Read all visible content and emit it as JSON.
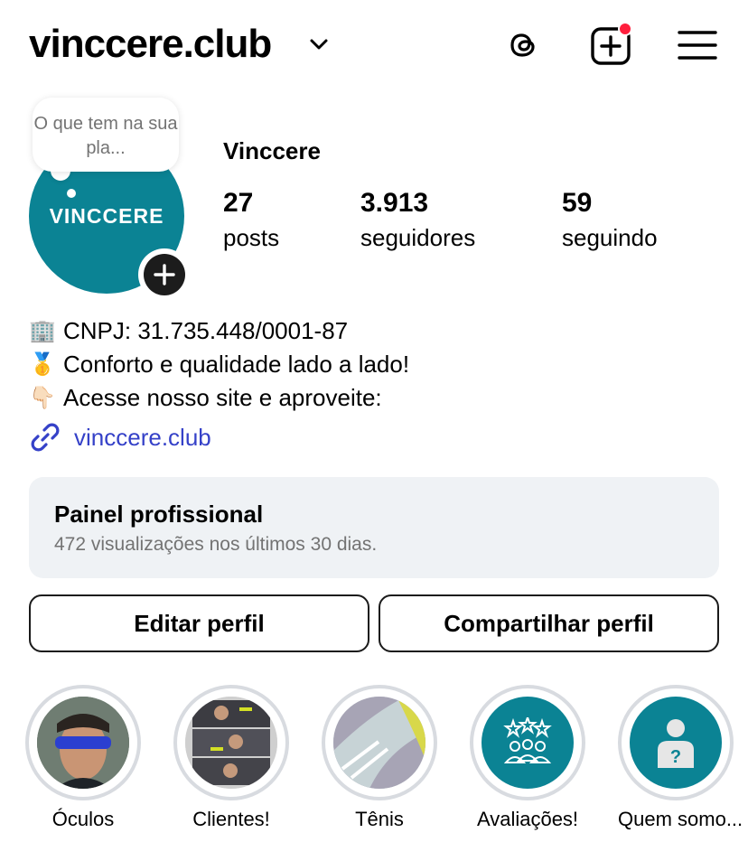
{
  "header": {
    "username": "vinccere.club",
    "icons": [
      "threads-icon",
      "new-post-icon",
      "menu-icon"
    ]
  },
  "note": {
    "text": "O que tem na sua pla..."
  },
  "profile": {
    "display_name": "Vinccere",
    "avatar_text": "VINCCERE",
    "stats": [
      {
        "value": "27",
        "label": "posts"
      },
      {
        "value": "3.913",
        "label": "seguidores"
      },
      {
        "value": "59",
        "label": "seguindo"
      }
    ]
  },
  "bio": {
    "lines": [
      {
        "emoji": "🏢",
        "text": "CNPJ: 31.735.448/0001-87"
      },
      {
        "emoji": "🥇",
        "text": "Conforto e qualidade lado a lado!"
      },
      {
        "emoji": "👇🏻",
        "text": "Acesse nosso site e aproveite:"
      }
    ],
    "link": "vinccere.club"
  },
  "panel": {
    "title": "Painel profissional",
    "subtitle": "472 visualizações nos últimos 30 dias."
  },
  "buttons": {
    "edit": "Editar perfil",
    "share": "Compartilhar perfil"
  },
  "highlights": [
    {
      "label": "Óculos"
    },
    {
      "label": "Clientes!"
    },
    {
      "label": "Tênis"
    },
    {
      "label": "Avaliações!"
    },
    {
      "label": "Quem somo..."
    }
  ],
  "colors": {
    "brand_teal": "#0b8394",
    "link_blue": "#3541c8",
    "notification_red": "#ff1f3d",
    "panel_bg": "#eff2f5"
  }
}
